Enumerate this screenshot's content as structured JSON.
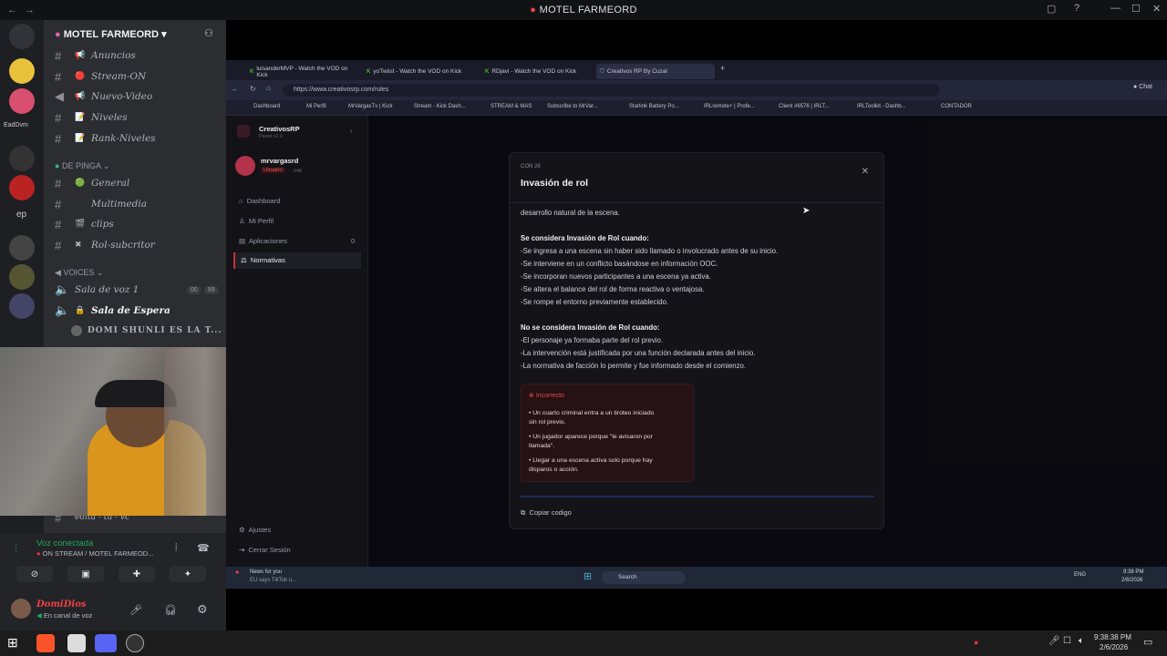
{
  "window": {
    "title": "MOTEL FARMEORD"
  },
  "server": {
    "name": "MOTEL FARMEORD"
  },
  "rail": {
    "label_1": "EadDvm",
    "label_2": "ep"
  },
  "channels": [
    {
      "name": "Anuncios",
      "emoji": "📢"
    },
    {
      "name": "Stream-ON",
      "emoji": "🔴"
    },
    {
      "name": "Nuevo-Video",
      "emoji": "📢"
    },
    {
      "name": "Niveles",
      "emoji": "📝"
    },
    {
      "name": "Rank-Niveles",
      "emoji": "📝"
    }
  ],
  "category_pinga": {
    "label": "DE PINGA"
  },
  "channels_2": [
    {
      "name": "General",
      "emoji": "🟢"
    },
    {
      "name": "Multimedia",
      "emoji": ""
    },
    {
      "name": "clips",
      "emoji": "🎬"
    },
    {
      "name": "Rol-subcritor",
      "emoji": "✖"
    }
  ],
  "category_voices": {
    "label": "VOICES"
  },
  "voice_channels": [
    {
      "name": "Sala de voz 1",
      "c1": "00",
      "c2": "99"
    },
    {
      "name": "Sala de Espera"
    }
  ],
  "voice_user": "DOMI SHUNLI ES LA T...",
  "hidden_channel": "edita - tu - vc",
  "voice_panel": {
    "status": "Voz conectada",
    "sub": "ON STREAM / MOTEL FARMEOD...",
    "username": "DomiDios",
    "user_status": "En canal de voz"
  },
  "browser": {
    "tabs": [
      "luisanderMVP - Watch the VOD on Kick",
      "yoTwiist - Watch the VOD on Kick",
      "RDjavi - Watch the VOD on Kick",
      "Creativos RP By Cuzal"
    ],
    "url": "https://www.creativosrp.com/rules",
    "bookmarks": [
      "Dashboard",
      "Mi Perfil",
      "MrVargasTv | Kick",
      "Stream - Kick Dash...",
      "STREAM & MAS",
      "Subscribe to MrVar...",
      "Starlink Battery Po...",
      "IRLremote+ | Profe...",
      "Client #6576 | IRLT...",
      "IRLToolkit - Dashb...",
      "CONTADOR"
    ],
    "chat_btn": "Chat"
  },
  "webapp": {
    "brand": "CreativosRP",
    "brand_sub": "Panel v2.0",
    "user": "mrvargasrd",
    "role": "Usuario",
    "role_id": "#48",
    "nav": [
      "Dashboard",
      "Mi Perfil",
      "Aplicaciones",
      "Normativas"
    ],
    "apps_count": "0",
    "bottom_nav": [
      "Ajustes",
      "Cerrar Sesión"
    ]
  },
  "modal": {
    "tag": "CON 26",
    "title": "Invasión de rol",
    "intro": "desarrollo natural de la escena.",
    "yes_head": "Se considera Invasión de Rol cuando:",
    "yes": [
      "-Se ingresa a una escena sin haber sido llamado o involucrado antes de su inicio.",
      "-Se interviene en un conflicto basándose en información OOC.",
      "-Se incorporan nuevos participantes a una escena ya activa.",
      "-Se altera el balance del rol de forma reactiva o ventajosa.",
      "-Se rompe el entorno previamente establecido."
    ],
    "no_head": "No se considera Invasión de Rol cuando:",
    "no": [
      "-El personaje ya formaba parte del rol previo.",
      "-La intervención está justificada por una función declarada antes del inicio.",
      "-La normativa de facción lo permite y fue informado desde el comienzo."
    ],
    "incorrect_label": "Incorrecto",
    "incorrect": [
      "• Un cuarto criminal entra a un tiroteo iniciado",
      "  sin rol previo.",
      "• Un jugador aparece porque \"le avisaron por",
      "  llamada\".",
      "• Llegar a una escena activa solo porque hay",
      "  disparos o acción."
    ],
    "copy": "Copiar codigo"
  },
  "inner_taskbar": {
    "news": "News for you",
    "news_sub": "EU says TikTok u...",
    "search": "Search",
    "lang": "ENG",
    "time": "9:38 PM",
    "date": "2/6/2026"
  },
  "outer_taskbar": {
    "time": "9:38:38 PM",
    "date": "2/6/2026"
  },
  "colors": {
    "accent": "#5865f2",
    "online": "#23a55a",
    "danger": "#ed4245"
  }
}
